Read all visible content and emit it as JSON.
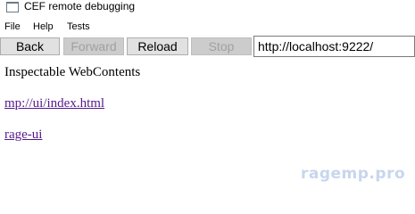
{
  "window": {
    "title": "CEF remote debugging",
    "icon": "window-icon"
  },
  "menu": {
    "items": [
      "File",
      "Help",
      "Tests"
    ]
  },
  "toolbar": {
    "back_label": "Back",
    "forward_label": "Forward",
    "reload_label": "Reload",
    "stop_label": "Stop",
    "address_value": "http://localhost:9222/"
  },
  "content": {
    "heading": "Inspectable WebContents",
    "links": [
      "mp://ui/index.html",
      "rage-ui"
    ]
  },
  "watermark": "ragemp.pro",
  "colors": {
    "link": "#551a8b",
    "button_bg": "#e1e1e1",
    "button_disabled_bg": "#cccccc",
    "watermark": "#c7d6ee"
  }
}
